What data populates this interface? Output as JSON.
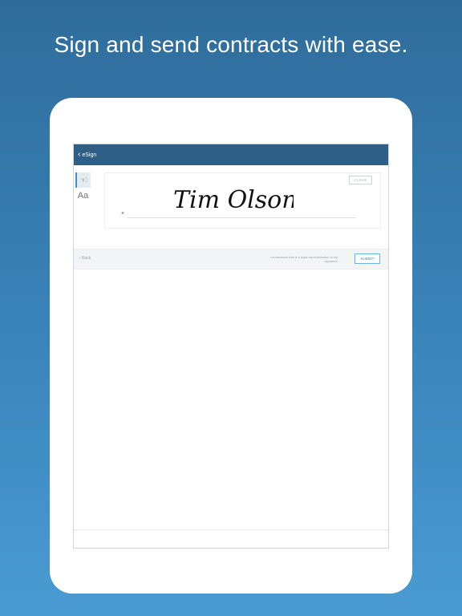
{
  "headline": "Sign and send contracts with ease.",
  "nav": {
    "back_label": "eSign"
  },
  "tools": [
    {
      "icon": "hand-draw-icon",
      "glyph": "☜"
    },
    {
      "icon": "type-text-icon",
      "glyph": "Aa"
    }
  ],
  "signature": {
    "text": "Tim Olson",
    "clear_label": "CLEAR",
    "x_mark": "×"
  },
  "actions": {
    "back_label": "‹  Back",
    "disclaimer": "I understand this is a legal representation of my signature",
    "submit_label": "SUBMIT"
  },
  "colors": {
    "nav_bar": "#2f5f87",
    "accent": "#3b8fd1",
    "background_top": "#2f6c9a",
    "background_bottom": "#4a9bd3"
  }
}
